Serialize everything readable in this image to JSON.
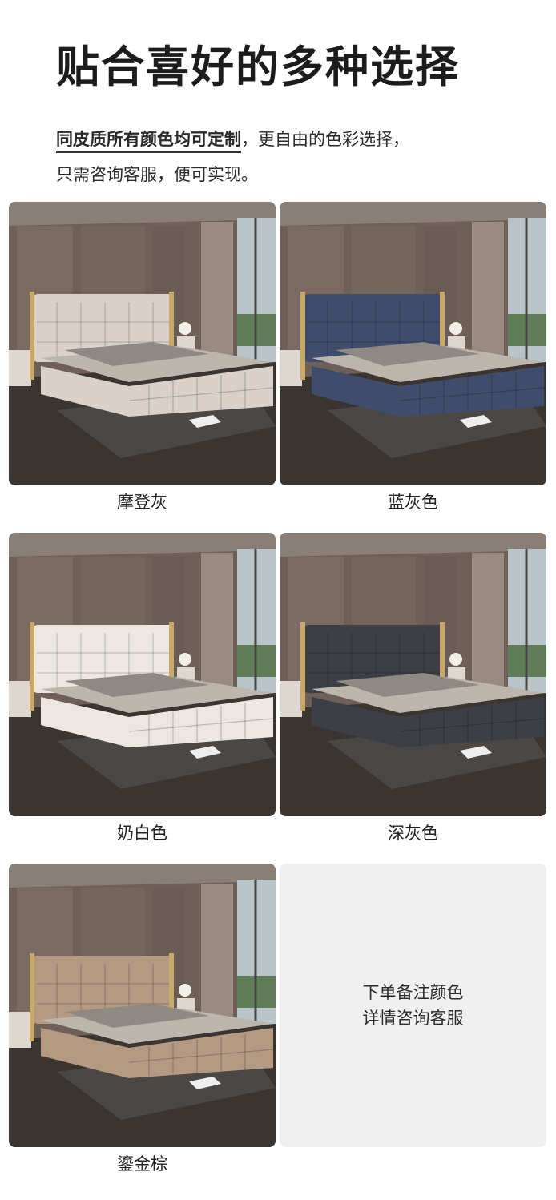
{
  "header": {
    "title": "贴合喜好的多种选择",
    "highlight": "同皮质所有颜色均可定制",
    "line1_rest": "，更自由的色彩选择，",
    "line2": "只需咨询客服，便可实现。"
  },
  "colors": {
    "wall": "#6e5f58",
    "floor": "#3b3532",
    "rug": "#4a4745"
  },
  "products": [
    {
      "label": "摩登灰",
      "bed_color": "#d9d1ca",
      "image_alt": "modern-grey-bed-photo"
    },
    {
      "label": "蓝灰色",
      "bed_color": "#3f4c6b",
      "image_alt": "blue-grey-bed-photo"
    },
    {
      "label": "奶白色",
      "bed_color": "#ece7e0",
      "image_alt": "cream-white-bed-photo"
    },
    {
      "label": "深灰色",
      "bed_color": "#3c3f45",
      "image_alt": "dark-grey-bed-photo"
    },
    {
      "label": "鎏金棕",
      "bed_color": "#b49a82",
      "image_alt": "gilded-brown-bed-photo"
    }
  ],
  "note": {
    "line1": "下单备注颜色",
    "line2": "详情咨询客服"
  }
}
